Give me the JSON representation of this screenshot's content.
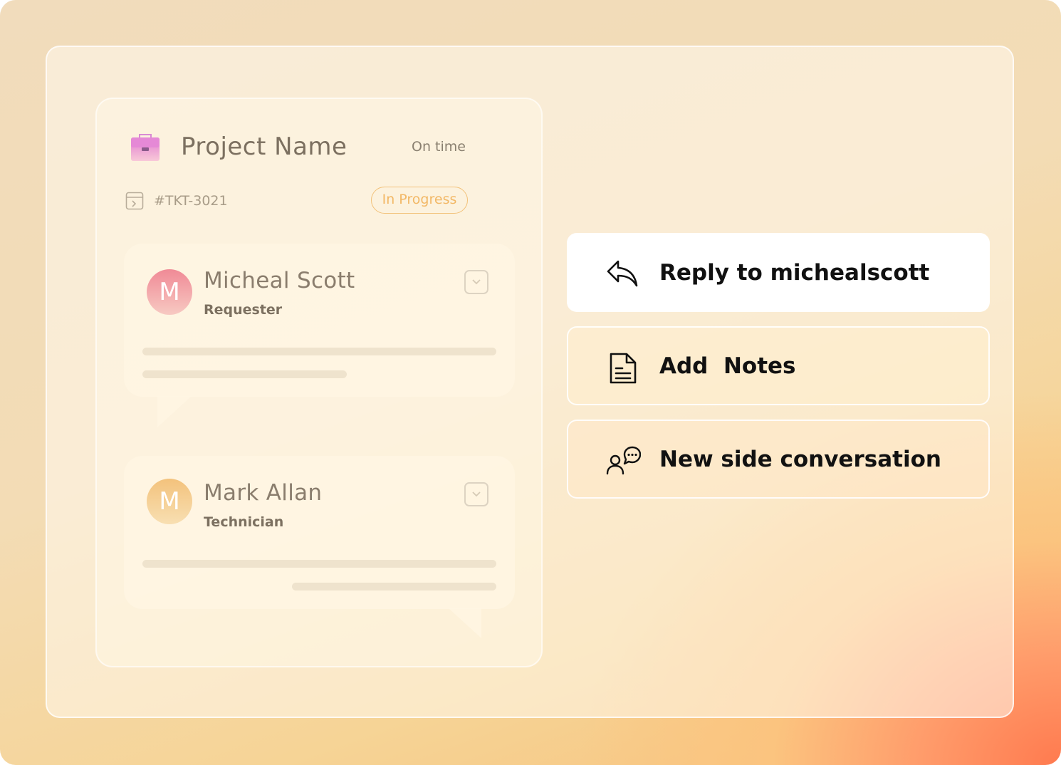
{
  "ticket": {
    "project_name": "Project Name",
    "schedule_status": "On time",
    "ticket_id": "#TKT-3021",
    "status_badge": "In Progress"
  },
  "messages": [
    {
      "avatar_letter": "M",
      "name": "Micheal Scott",
      "role": "Requester"
    },
    {
      "avatar_letter": "M",
      "name": "Mark Allan",
      "role": "Technician"
    }
  ],
  "actions": {
    "reply": {
      "label": "Reply to michealscott",
      "icon": "reply-icon"
    },
    "notes": {
      "label": "Add  Notes",
      "icon": "document-icon"
    },
    "side_conversation": {
      "label": "New side conversation",
      "icon": "user-chat-icon"
    }
  },
  "colors": {
    "badge": "#f2c27a",
    "requester_avatar": "#f08a96",
    "technician_avatar": "#f3c27c"
  }
}
